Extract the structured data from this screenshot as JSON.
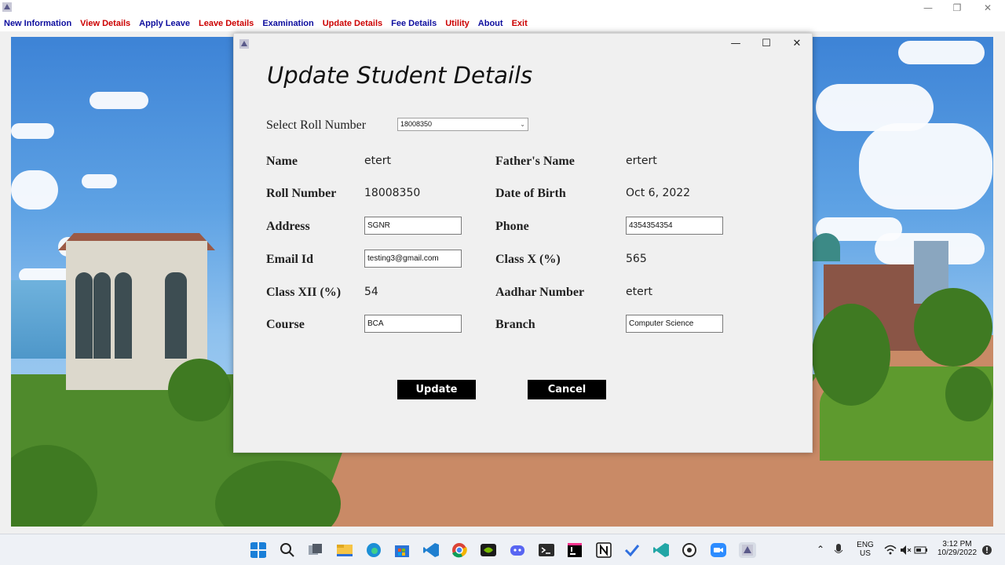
{
  "window": {
    "minimize": "—",
    "restore": "❐",
    "close": "✕"
  },
  "menu": [
    {
      "label": "New Information",
      "color": "#0d0d9e"
    },
    {
      "label": "View Details",
      "color": "#cc0000"
    },
    {
      "label": "Apply Leave",
      "color": "#0d0d9e"
    },
    {
      "label": "Leave Details",
      "color": "#cc0000"
    },
    {
      "label": "Examination",
      "color": "#0d0d9e"
    },
    {
      "label": "Update Details",
      "color": "#cc0000"
    },
    {
      "label": "Fee Details",
      "color": "#0d0d9e"
    },
    {
      "label": "Utility",
      "color": "#cc0000"
    },
    {
      "label": "About",
      "color": "#0d0d9e"
    },
    {
      "label": "Exit",
      "color": "#cc0000"
    }
  ],
  "dialog": {
    "title": "Update Student Details",
    "minimize": "—",
    "maximize": "☐",
    "close": "✕",
    "select_roll_label": "Select Roll Number",
    "selected_roll": "18008350",
    "fields": {
      "name_label": "Name",
      "name_value": "etert",
      "father_label": "Father's Name",
      "father_value": "ertert",
      "roll_label": "Roll Number",
      "roll_value": "18008350",
      "dob_label": "Date of Birth",
      "dob_value": "Oct 6, 2022",
      "address_label": "Address",
      "address_value": "SGNR",
      "phone_label": "Phone",
      "phone_value": "4354354354",
      "email_label": "Email Id",
      "email_value": "testing3@gmail.com",
      "classx_label": "Class X (%)",
      "classx_value": "565",
      "classxii_label": "Class XII (%)",
      "classxii_value": "54",
      "aadhar_label": "Aadhar Number",
      "aadhar_value": "etert",
      "course_label": "Course",
      "course_value": "BCA",
      "branch_label": "Branch",
      "branch_value": "Computer Science"
    },
    "update_button": "Update",
    "cancel_button": "Cancel"
  },
  "taskbar": {
    "icons": [
      "windows-start-icon",
      "search-icon",
      "task-view-icon",
      "file-explorer-icon",
      "edge-icon",
      "store-icon",
      "vscode-icon",
      "chrome-icon",
      "nvidia-icon",
      "discord-icon",
      "terminal-icon",
      "intellij-icon",
      "notion-icon",
      "todo-icon",
      "visual-studio-icon",
      "obs-icon",
      "zoom-icon",
      "java-app-icon"
    ],
    "lang_top": "ENG",
    "lang_bottom": "US",
    "time": "3:12 PM",
    "date": "10/29/2022"
  }
}
